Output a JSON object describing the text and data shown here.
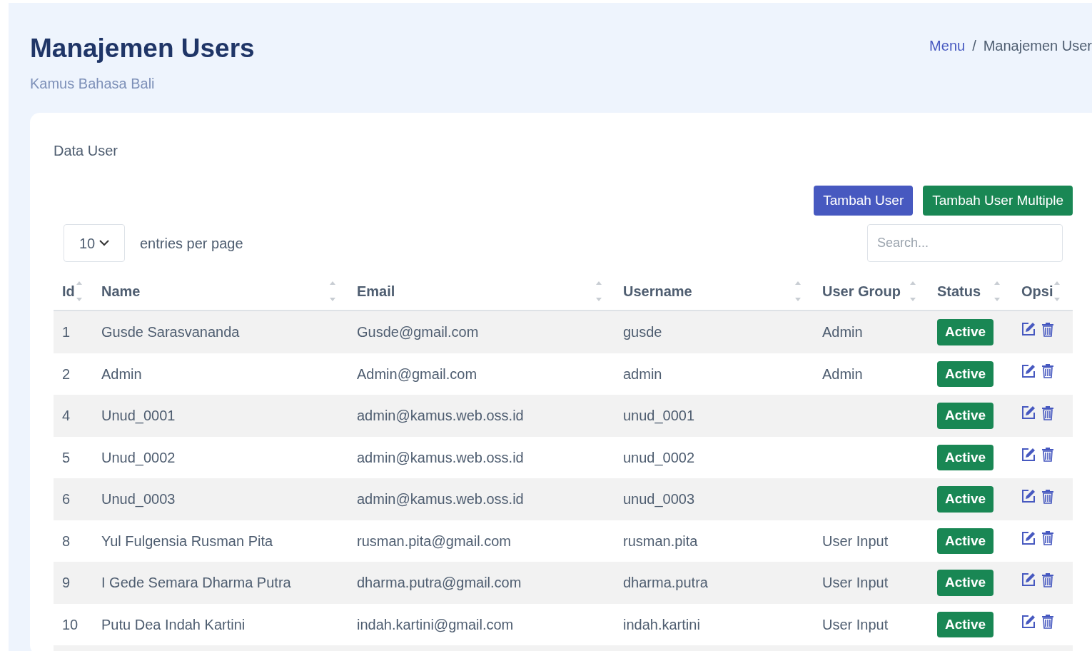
{
  "header": {
    "title": "Manajemen Users",
    "subtitle": "Kamus Bahasa Bali",
    "breadcrumb": [
      "Menu",
      "Manajemen User"
    ],
    "breadcrumb_separator": "/"
  },
  "card": {
    "title": "Data User",
    "buttons": [
      {
        "label": "Tambah User",
        "kind": "primary"
      },
      {
        "label": "Tambah User Multiple",
        "kind": "success"
      }
    ],
    "page_size": {
      "value": "10",
      "label": "entries per page"
    },
    "search": {
      "placeholder": "Search..."
    },
    "table": {
      "columns": [
        "Id",
        "Name",
        "Email",
        "Username",
        "User Group",
        "Status",
        "Opsi"
      ],
      "rows": [
        {
          "id": "1",
          "name": "Gusde Sarasvananda",
          "email": "Gusde@gmail.com",
          "username": "gusde",
          "user_group": "Admin",
          "status": "Active"
        },
        {
          "id": "2",
          "name": "Admin",
          "email": "Admin@gmail.com",
          "username": "admin",
          "user_group": "Admin",
          "status": "Active"
        },
        {
          "id": "4",
          "name": "Unud_0001",
          "email": "admin@kamus.web.oss.id",
          "username": "unud_0001",
          "status": "Active"
        },
        {
          "id": "5",
          "name": "Unud_0002",
          "email": "admin@kamus.web.oss.id",
          "username": "unud_0002",
          "status": "Active"
        },
        {
          "id": "6",
          "name": "Unud_0003",
          "email": "admin@kamus.web.oss.id",
          "username": "unud_0003",
          "status": "Active"
        },
        {
          "id": "8",
          "name": "Yul Fulgensia Rusman Pita",
          "email": "rusman.pita@gmail.com",
          "username": "rusman.pita",
          "user_group": "User Input",
          "status": "Active"
        },
        {
          "id": "9",
          "name": "I Gede Semara Dharma Putra",
          "email": "dharma.putra@gmail.com",
          "username": "dharma.putra",
          "user_group": "User Input",
          "status": "Active"
        },
        {
          "id": "10",
          "name": "Putu Dea Indah Kartini",
          "email": "indah.kartini@gmail.com",
          "username": "indah.kartini",
          "user_group": "User Input",
          "status": "Active"
        }
      ]
    }
  }
}
